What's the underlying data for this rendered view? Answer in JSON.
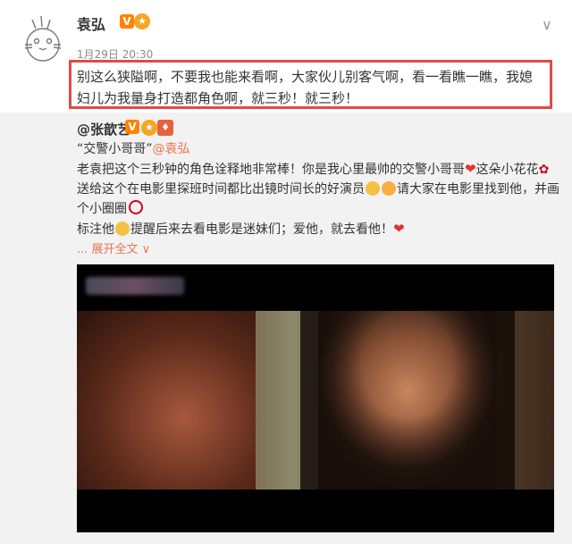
{
  "post": {
    "username": "袁弘",
    "verified_mark": "V",
    "badge_icon": "fan-badge-icon",
    "timestamp": "1月29日 20:30",
    "text": "别这么狭隘啊，不要我也能来看啊，大家伙儿别客气啊，看一看瞧一瞧，我媳妇儿为我量身打造都角色啊，就三秒！就三秒！"
  },
  "repost": {
    "username": "@张歆艺",
    "verified_mark": "V",
    "quote": "“交警小哥哥”",
    "mention": "@袁弘",
    "body_1": "老袁把这个三秒钟的角色诠释地非常棒！你是我心里最帅的交警小哥哥",
    "body_2": "这朵小花花",
    "body_3": "送给这个在电影里探班时间都比出镜时间长的好演员",
    "body_4": "请大家在电影里找到他，并画个小圈圈",
    "body_5": "标注他",
    "body_6": "提醒后来去看电影是迷妹们；爱他，就去看他！",
    "expand_label": "... 展开全文 ∨"
  },
  "colors": {
    "highlight_border": "#e04a4a",
    "link": "#eb7350",
    "verified": "#ff8200",
    "repost_bg": "#f2f2f2"
  }
}
